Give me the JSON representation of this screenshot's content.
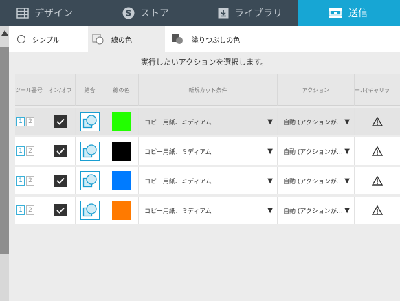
{
  "top_tabs": [
    {
      "label": "デザイン",
      "icon": "grid-icon"
    },
    {
      "label": "ストア",
      "icon": "store-s-icon"
    },
    {
      "label": "ライブラリ",
      "icon": "download-icon"
    },
    {
      "label": "送信",
      "icon": "cutter-icon",
      "active": true
    }
  ],
  "sub_tabs": [
    {
      "label": "シンプル",
      "icon": "radio-icon"
    },
    {
      "label": "線の色",
      "icon": "line-color-icon",
      "active": true
    },
    {
      "label": "塗りつぶしの色",
      "icon": "fill-color-icon"
    }
  ],
  "instruction": "実行したいアクションを選択します。",
  "columns": [
    "ツール番号",
    "オン/オフ",
    "結合",
    "線の色",
    "新規カット条件",
    "アクション",
    "ール(キャリッ"
  ],
  "rows": [
    {
      "tool": [
        "1",
        "2"
      ],
      "color": "#22ff00",
      "condition": "コピー用紙、ミディアム",
      "action": "自動 (アクションが…",
      "selected": true
    },
    {
      "tool": [
        "1",
        "2"
      ],
      "color": "#000000",
      "condition": "コピー用紙、ミディアム",
      "action": "自動 (アクションが…",
      "selected": false
    },
    {
      "tool": [
        "1",
        "2"
      ],
      "color": "#007bff",
      "condition": "コピー用紙、ミディアム",
      "action": "自動 (アクションが…",
      "selected": false
    },
    {
      "tool": [
        "1",
        "2"
      ],
      "color": "#ff7a00",
      "condition": "コピー用紙、ミディアム",
      "action": "自動 (アクションが…",
      "selected": false
    }
  ],
  "dropdown_glyph": "▼",
  "colors": {
    "topbar": "#3b4a56",
    "accent": "#17a6d4",
    "warning": "#333333"
  }
}
